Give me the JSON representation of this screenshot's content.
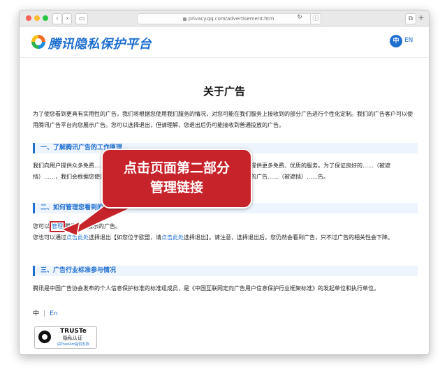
{
  "browser": {
    "url": "privacy.qq.com/advertisement.htm",
    "back_glyph": "‹",
    "forward_glyph": "›",
    "sidebar_glyph": "▭",
    "reload_glyph": "↻",
    "info_glyph": "ⓘ",
    "tabs_glyph": "⧉",
    "add_glyph": "+",
    "dot_colors": [
      "#fe5f57",
      "#febc2e",
      "#28c840"
    ]
  },
  "header": {
    "logo_text": "腾讯隐私保护平台",
    "lang_zh": "中",
    "lang_en": "EN"
  },
  "page": {
    "title": "关于广告",
    "intro": "为了使您看到更具有实用性的广告，我们将根据您使用我们服务的情况，对您可能在我们服务上接收到的部分广告进行个性化定制。我们的广告客户可以使用腾讯广告平台向您展示广告。您可以选择退出，但请理解，您退出后仍可能接收到普通投放的广告。",
    "sections": [
      {
        "heading": "一、了解腾讯广告的工作原理",
        "body": "我们向用户提供众多免费……（被遮挡）……业务，如果没有广告收入，我们将难以向您提供更多免费、优质的服务。为了保证良好的……（被遮挡）……，我们会根据您使用我们服务的情况，尽可能向您展示您可能更感兴趣、更实用的广告……（被遮挡）……告。"
      },
      {
        "heading": "二、如何管理您看到的广告",
        "line1_before": "您可以",
        "line1_link": "管理",
        "line1_after": "腾讯为您展示的广告。",
        "line2_before": "您也可以通过",
        "line2_link1": "点击此处",
        "line2_mid": "选择退出【如您位于欧盟，请",
        "line2_link2": "点击此处",
        "line2_after": "选择退出】。请注意，选择退出后，您仍然会看到广告，只不过广告的相关性会下降。"
      },
      {
        "heading": "三、广告行业标准参与情况",
        "body": "腾讯是中国广告协会发布的个人信息保护标准的标准组成员，是《中国互联网定向广告用户信息保护行业框架标准》的发起单位和执行单位。"
      }
    ]
  },
  "footer": {
    "lang_zh": "中",
    "separator": "|",
    "lang_en": "En",
    "truste_title": "TRUSTe",
    "truste_sub": "隐私认证",
    "truste_small": "由TrustArc提供支持"
  },
  "annotation": {
    "line1": "点击页面第二部分",
    "line2": "管理链接",
    "color": "#c7232a"
  }
}
